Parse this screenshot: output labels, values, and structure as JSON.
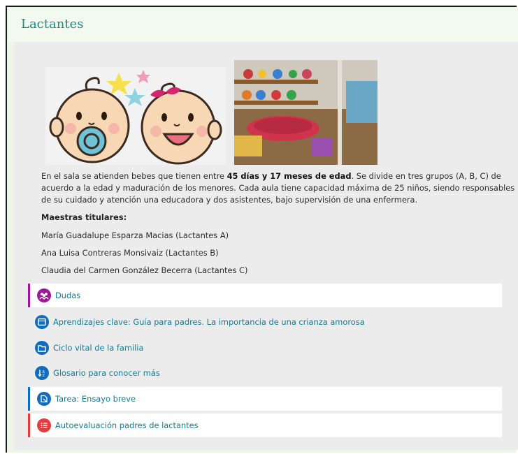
{
  "section": {
    "title": "Lactantes"
  },
  "images": {
    "babies_alt": "Ilustración de dos bebés",
    "room_alt": "Sala de lactantes"
  },
  "summary": {
    "part1": "En el sala se atienden bebes que tienen entre ",
    "highlight": "45 días y 17 meses de edad",
    "part2": ". Se divide en tres grupos (A, B, C) de acuerdo a la edad y maduración de los menores. Cada aula tiene capacidad máxima de 25 niños, siendo responsables de su cuidado y atención una educadora y dos asistentes, bajo supervisión de una enfermera."
  },
  "teachers": {
    "heading": "Maestras titulares:",
    "list": [
      "María Guadalupe Esparza Macias (Lactantes A)",
      "Ana Luisa Contreras Monsivaiz (Lactantes B)",
      "Claudia del Carmen González Becerra (Lactantes C)"
    ]
  },
  "activities": [
    {
      "label": "Dudas",
      "icon": "forum-icon",
      "color": "#a2179a"
    },
    {
      "label": "Aprendizajes clave: Guía para padres. La importancia de una crianza amorosa",
      "icon": "page-icon",
      "color": "#0f6cbf"
    },
    {
      "label": "Ciclo vital de la familia",
      "icon": "folder-icon",
      "color": "#0f6cbf"
    },
    {
      "label": "Glosario para conocer más",
      "icon": "glossary-icon",
      "color": "#0f6cbf"
    },
    {
      "label": "Tarea: Ensayo breve",
      "icon": "assignment-icon",
      "color": "#0f6cbf"
    },
    {
      "label": "Autoevaluación padres de lactantes",
      "icon": "quiz-icon",
      "color": "#e83c3c"
    }
  ]
}
